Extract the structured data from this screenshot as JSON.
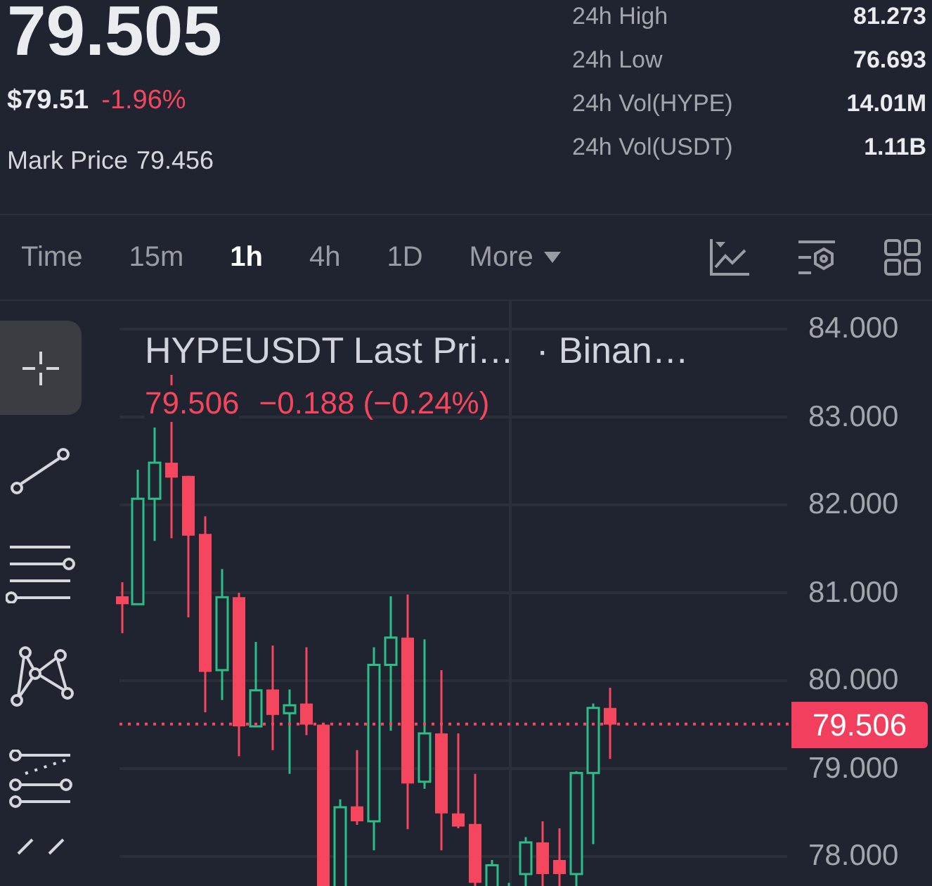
{
  "header": {
    "last_price": "79.505",
    "usd_price": "$79.51",
    "change_percent": "-1.96%",
    "mark_price_label": "Mark Price",
    "mark_price": "79.456"
  },
  "stats": [
    {
      "label": "24h High",
      "value": "81.273"
    },
    {
      "label": "24h Low",
      "value": "76.693"
    },
    {
      "label": "24h Vol(HYPE)",
      "value": "14.01M"
    },
    {
      "label": "24h Vol(USDT)",
      "value": "1.11B"
    }
  ],
  "intervals": [
    {
      "label": "Time",
      "selected": false,
      "kind": "text"
    },
    {
      "label": "15m",
      "selected": false,
      "kind": "text"
    },
    {
      "label": "1h",
      "selected": true,
      "kind": "text"
    },
    {
      "label": "4h",
      "selected": false,
      "kind": "text"
    },
    {
      "label": "1D",
      "selected": false,
      "kind": "text"
    },
    {
      "label": "More",
      "selected": false,
      "kind": "dropdown"
    }
  ],
  "drawing_tools": [
    {
      "kind": "crosshair",
      "selected": true
    },
    {
      "kind": "trend_line",
      "selected": false
    },
    {
      "kind": "horizontal_lines",
      "selected": false
    },
    {
      "kind": "pattern",
      "selected": false
    },
    {
      "kind": "fib",
      "selected": false
    },
    {
      "kind": "brush",
      "selected": false
    }
  ],
  "chart": {
    "title": "HYPEUSDT Last Pri…",
    "exchange": "· Binan…",
    "last": "79.506",
    "change": "−0.188 (−0.24%)",
    "price_axis": [
      "84.000",
      "83.000",
      "82.000",
      "81.000",
      "80.000",
      "79.000",
      "78.000"
    ],
    "current_price_tag": "79.506"
  }
}
